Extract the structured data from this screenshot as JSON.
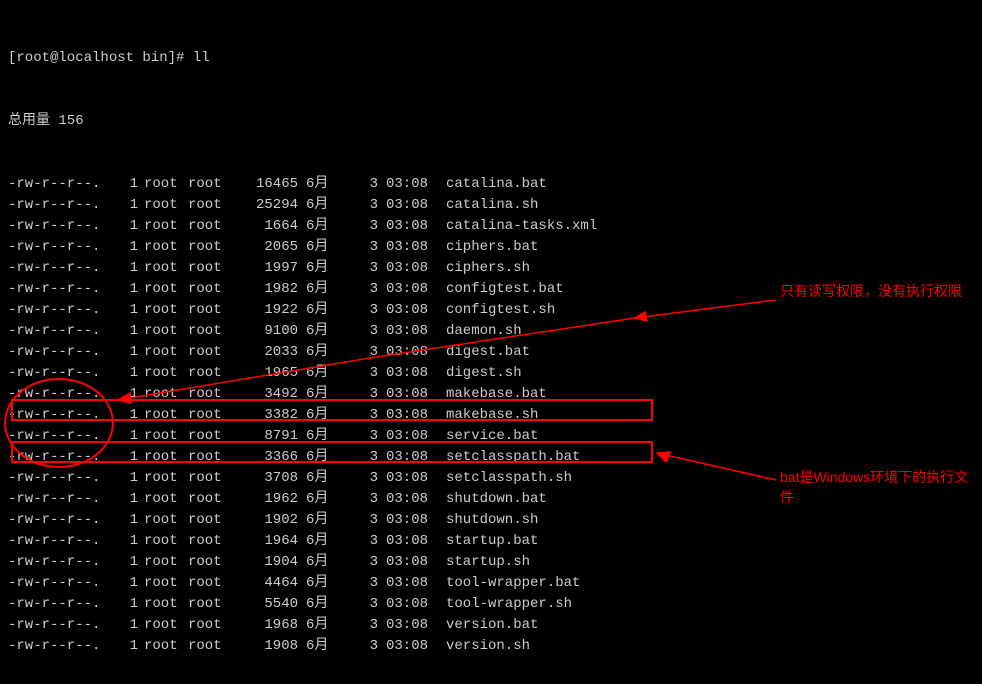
{
  "prompt": "[root@localhost bin]# ll",
  "total_label": "总用量 156",
  "columns": {
    "perm": "-rw-r--r--.",
    "links": "1",
    "owner": "root",
    "group": "root",
    "month": "6月",
    "day": "3",
    "time": "03:08"
  },
  "files": [
    {
      "size": "16465",
      "name": "catalina.bat"
    },
    {
      "size": "25294",
      "name": "catalina.sh"
    },
    {
      "size": "1664",
      "name": "catalina-tasks.xml"
    },
    {
      "size": "2065",
      "name": "ciphers.bat"
    },
    {
      "size": "1997",
      "name": "ciphers.sh"
    },
    {
      "size": "1982",
      "name": "configtest.bat"
    },
    {
      "size": "1922",
      "name": "configtest.sh"
    },
    {
      "size": "9100",
      "name": "daemon.sh"
    },
    {
      "size": "2033",
      "name": "digest.bat"
    },
    {
      "size": "1965",
      "name": "digest.sh"
    },
    {
      "size": "3492",
      "name": "makebase.bat"
    },
    {
      "size": "3382",
      "name": "makebase.sh"
    },
    {
      "size": "8791",
      "name": "service.bat"
    },
    {
      "size": "3366",
      "name": "setclasspath.bat"
    },
    {
      "size": "3708",
      "name": "setclasspath.sh"
    },
    {
      "size": "1962",
      "name": "shutdown.bat"
    },
    {
      "size": "1902",
      "name": "shutdown.sh"
    },
    {
      "size": "1964",
      "name": "startup.bat"
    },
    {
      "size": "1904",
      "name": "startup.sh"
    },
    {
      "size": "4464",
      "name": "tool-wrapper.bat"
    },
    {
      "size": "5540",
      "name": "tool-wrapper.sh"
    },
    {
      "size": "1968",
      "name": "version.bat"
    },
    {
      "size": "1908",
      "name": "version.sh"
    }
  ],
  "annotations": {
    "perm_note": "只有读写权限，没有执行权限",
    "bat_note": "bat是Windows环境下的执行文件"
  }
}
